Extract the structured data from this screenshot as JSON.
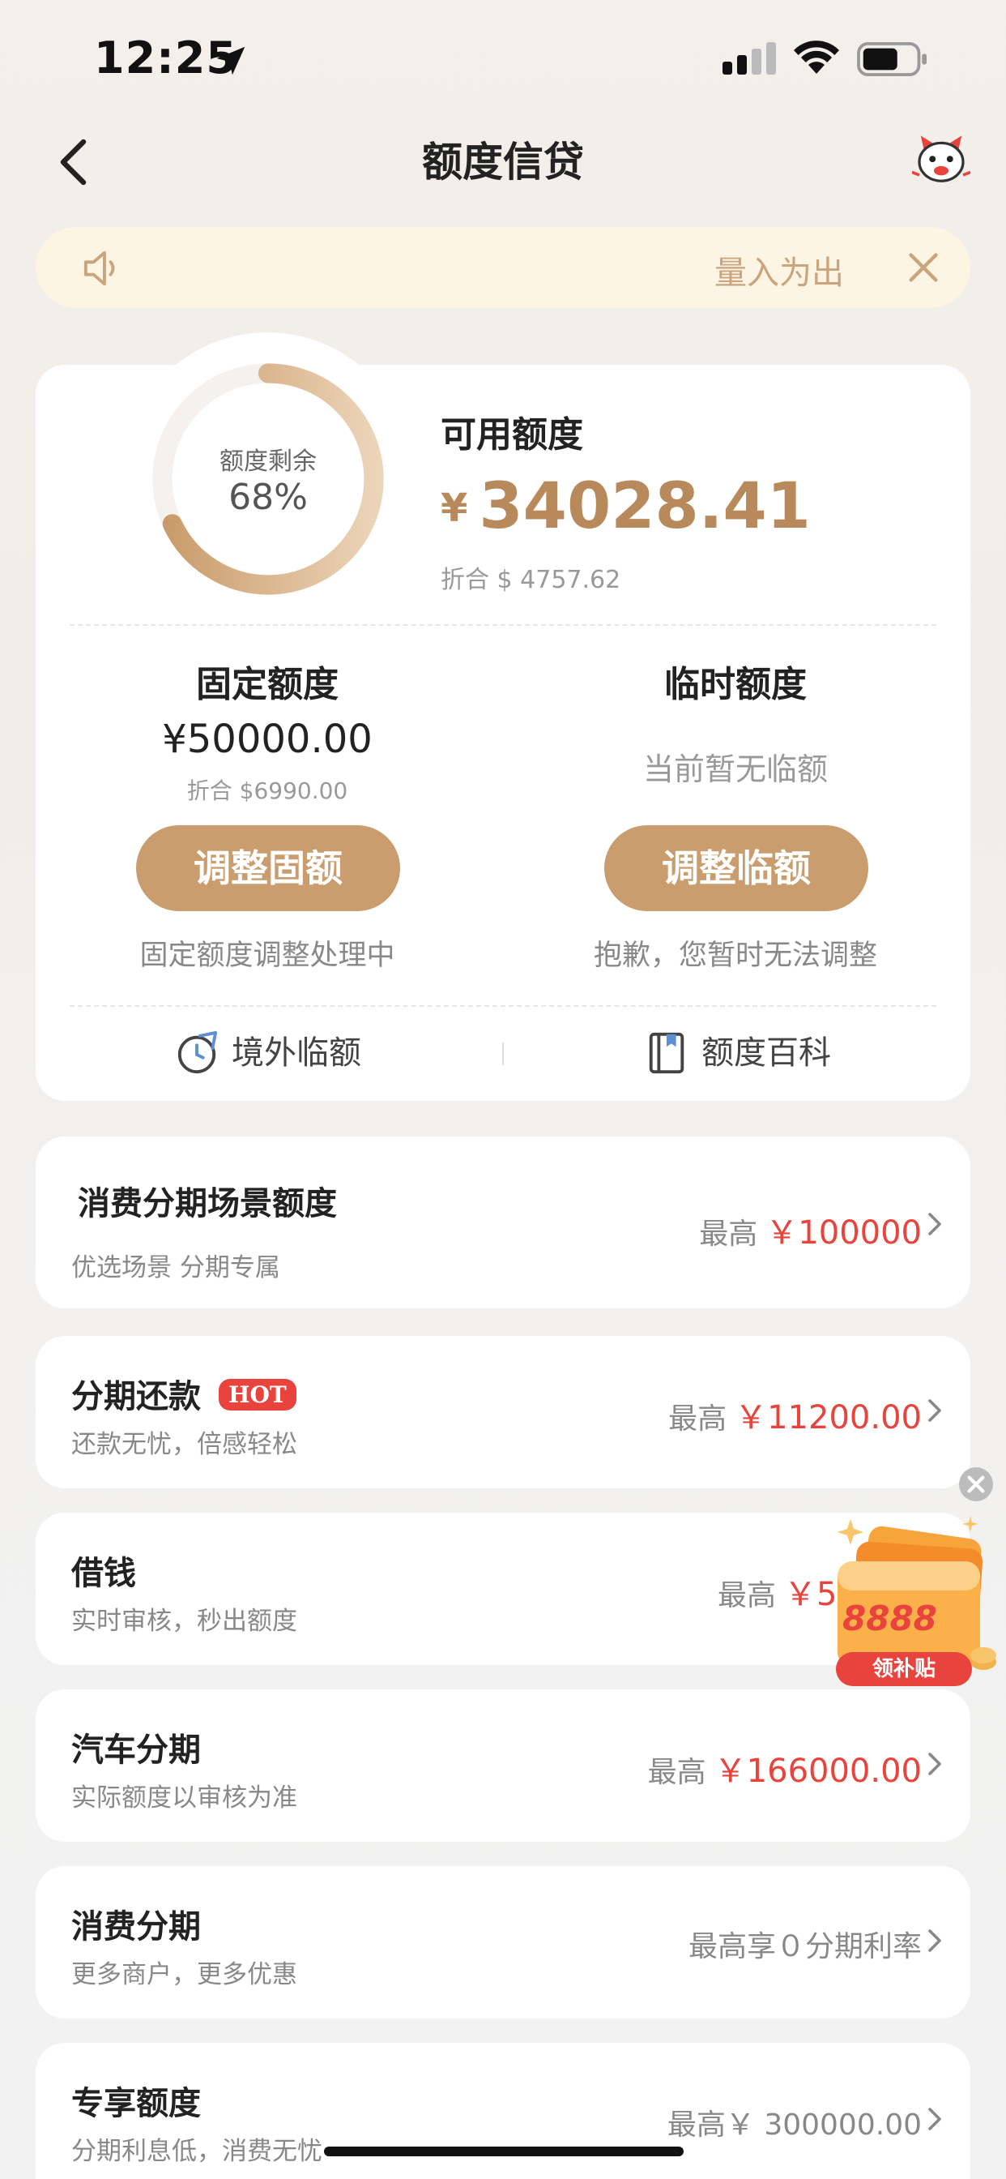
{
  "status_bar": {
    "time": "12:25"
  },
  "nav": {
    "title": "额度信贷"
  },
  "notice": {
    "text": "量入为出"
  },
  "quota": {
    "ring_label": "额度剩余",
    "ring_percent": "68%",
    "ring_fraction": 0.68,
    "available_title": "可用额度",
    "available_currency": "¥",
    "available_amount": "34028.41",
    "available_usd": "折合 $ 4757.62"
  },
  "fixed": {
    "title": "固定额度",
    "amount": "¥50000.00",
    "usd": "折合 $6990.00",
    "button": "调整固额",
    "note": "固定额度调整处理中"
  },
  "temporary": {
    "title": "临时额度",
    "none_text": "当前暂无临额",
    "button": "调整临额",
    "note": "抱歉，您暂时无法调整"
  },
  "shortcuts": [
    {
      "label": "境外临额",
      "icon": "plane-clock-icon"
    },
    {
      "label": "额度百科",
      "icon": "book-icon"
    }
  ],
  "rows": [
    {
      "title": "消费分期场景额度",
      "sub": "优选场景 分期专属",
      "prefix": "最高",
      "value": "￥100000"
    },
    {
      "title": "分期还款",
      "badge": "HOT",
      "sub": "还款无忧，倍感轻松",
      "prefix": "最高",
      "value": "￥11200.00"
    },
    {
      "title": "借钱",
      "sub": "实时审核，秒出额度",
      "prefix": "最高",
      "value": "￥50"
    },
    {
      "title": "汽车分期",
      "sub": "实际额度以审核为准",
      "prefix": "最高",
      "value": "￥166000.00"
    },
    {
      "title": "消费分期",
      "sub": "更多商户，更多优惠",
      "prefix": "最高享０分期利率",
      "value": ""
    },
    {
      "title": "专享额度",
      "sub": "分期利息低，消费无忧",
      "prefix": "最高￥ 300000.00",
      "value": ""
    }
  ],
  "float_ad": {
    "amount": "8888",
    "button": "领补贴"
  },
  "colors": {
    "accent": "#c99d6d",
    "gold_text": "#b8895a",
    "red": "#e8433c",
    "notice_bg": "#fdf5e4"
  }
}
